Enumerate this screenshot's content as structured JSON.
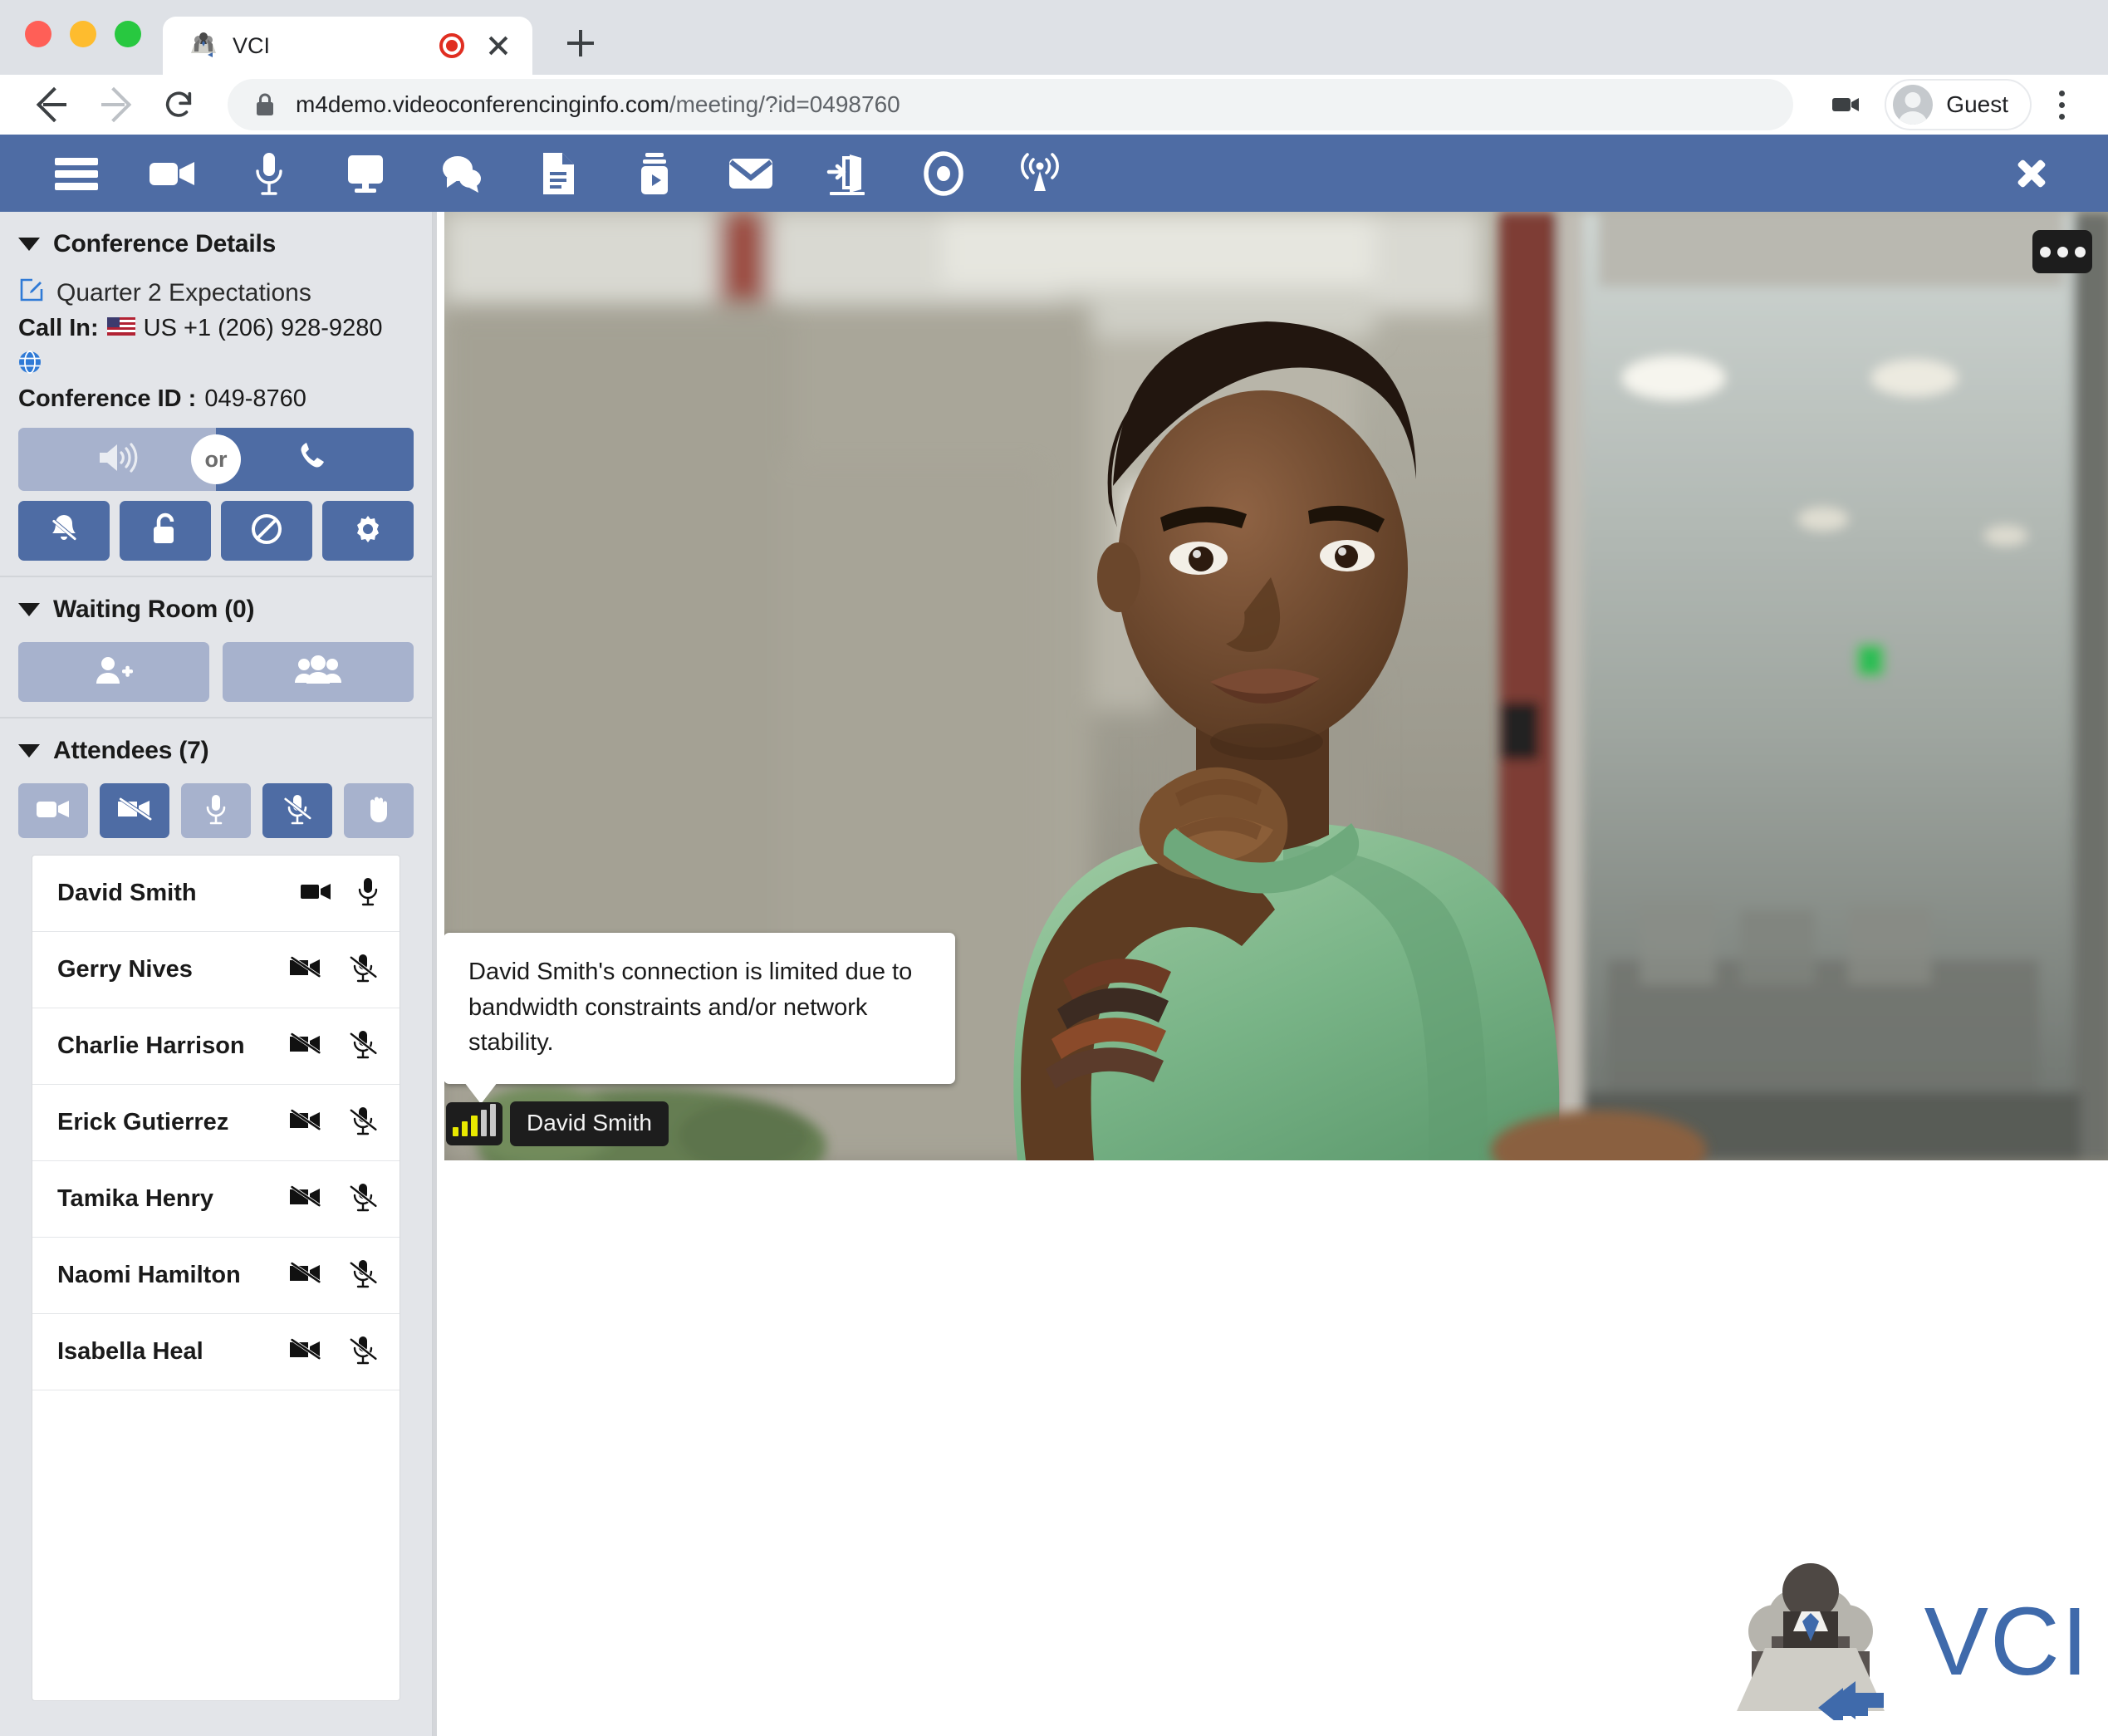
{
  "browser": {
    "tab": {
      "title": "VCI",
      "favicon_icon": "conference-table-icon",
      "recording_icon": "recording-dot-icon",
      "close_icon": "close-icon"
    },
    "new_tab_icon": "plus-icon",
    "back_icon": "arrow-left-icon",
    "forward_icon": "arrow-right-icon",
    "reload_icon": "reload-icon",
    "lock_icon": "lock-icon",
    "url_domain": "m4demo.videoconferencinginfo.com",
    "url_path": "/meeting/?id=0498760",
    "camera_indicator_icon": "camera-icon",
    "profile_label": "Guest",
    "profile_icon": "person-avatar-icon",
    "menu_icon": "kebab-menu-icon"
  },
  "app_toolbar": {
    "accent_color": "#4e6ca4",
    "items": [
      {
        "name": "menu",
        "icon": "hamburger-menu-icon"
      },
      {
        "name": "camera",
        "icon": "video-camera-icon"
      },
      {
        "name": "microphone",
        "icon": "microphone-icon"
      },
      {
        "name": "share-screen",
        "icon": "monitor-icon"
      },
      {
        "name": "chat",
        "icon": "chat-bubbles-icon"
      },
      {
        "name": "documents",
        "icon": "document-icon"
      },
      {
        "name": "media-player",
        "icon": "media-play-icon"
      },
      {
        "name": "mail",
        "icon": "envelope-icon"
      },
      {
        "name": "breakout-rooms",
        "icon": "exit-door-icon"
      },
      {
        "name": "record",
        "icon": "record-circle-icon"
      },
      {
        "name": "broadcast",
        "icon": "broadcast-antenna-icon"
      }
    ],
    "close_icon": "close-x-icon"
  },
  "sidebar": {
    "conference_details": {
      "title": "Conference Details",
      "caret_icon": "caret-down-icon",
      "edit_icon": "edit-pencil-icon",
      "meeting_name": "Quarter 2 Expectations",
      "callin_label": "Call In:",
      "flag_icon": "us-flag-icon",
      "callin_number": "US +1 (206) 928-9280",
      "globe_icon": "globe-icon",
      "conference_id_label": "Conference ID :",
      "conference_id": "049-8760",
      "join_audio_icon": "speaker-icon",
      "or_label": "or",
      "dial_icon": "phone-handset-icon",
      "actions": [
        {
          "name": "mute-notifications",
          "icon": "bell-slash-icon"
        },
        {
          "name": "lock-meeting",
          "icon": "unlocked-padlock-icon"
        },
        {
          "name": "block",
          "icon": "no-entry-icon"
        },
        {
          "name": "settings",
          "icon": "gear-icon"
        }
      ]
    },
    "waiting_room": {
      "title": "Waiting Room (0)",
      "caret_icon": "caret-down-icon",
      "buttons": [
        {
          "name": "admit-one",
          "icon": "person-add-icon"
        },
        {
          "name": "admit-all",
          "icon": "people-group-icon"
        }
      ]
    },
    "attendees": {
      "title": "Attendees (7)",
      "caret_icon": "caret-down-icon",
      "filters": [
        {
          "name": "camera-on-all",
          "icon": "video-camera-icon",
          "active": false
        },
        {
          "name": "camera-off-all",
          "icon": "video-camera-slash-icon",
          "active": true
        },
        {
          "name": "mic-on-all",
          "icon": "microphone-icon",
          "active": false
        },
        {
          "name": "mic-off-all",
          "icon": "microphone-slash-icon",
          "active": true
        },
        {
          "name": "lower-hands",
          "icon": "raised-hand-icon",
          "active": false
        }
      ],
      "rows": [
        {
          "name": "David Smith",
          "camera": "on",
          "mic": "on"
        },
        {
          "name": "Gerry Nives",
          "camera": "off",
          "mic": "off"
        },
        {
          "name": "Charlie Harrison",
          "camera": "off",
          "mic": "off"
        },
        {
          "name": "Erick Gutierrez",
          "camera": "off",
          "mic": "off"
        },
        {
          "name": "Tamika Henry",
          "camera": "off",
          "mic": "off"
        },
        {
          "name": "Naomi Hamilton",
          "camera": "off",
          "mic": "off"
        },
        {
          "name": "Isabella Heal",
          "camera": "off",
          "mic": "off"
        }
      ]
    }
  },
  "stage": {
    "more_icon": "ellipsis-icon",
    "tooltip_text": "David Smith's connection is limited due to bandwidth constraints and/or network stability.",
    "signal_icon": "signal-bars-icon",
    "signal_bars_filled": 3,
    "signal_bars_total": 5,
    "signal_color": "#e8e800",
    "speaker_name": "David Smith",
    "logo_text": "VCI",
    "logo_icon": "conference-table-icon",
    "logo_color": "#3f6aab"
  }
}
